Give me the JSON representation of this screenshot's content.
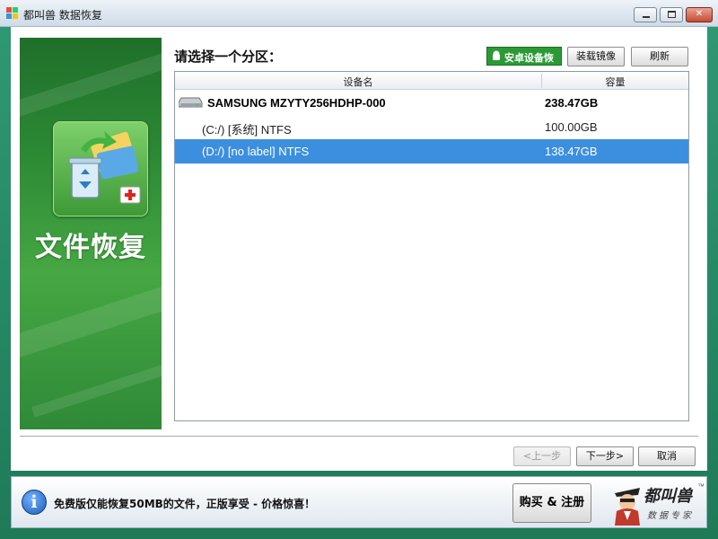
{
  "window": {
    "title": "都叫兽 数据恢复",
    "controls": {
      "minimize": "minimize",
      "maximize": "maximize",
      "close": "✕"
    }
  },
  "banner": {
    "title": "文件恢复"
  },
  "heading": "请选择一个分区：",
  "actions": {
    "android_recovery": "安卓设备恢复",
    "mount_image": "装载镜像",
    "refresh": "刷新"
  },
  "table": {
    "columns": [
      "设备名",
      "容量"
    ],
    "disk": {
      "name": "SAMSUNG MZYTY256HDHP-000",
      "capacity": "238.47GB"
    },
    "partitions": [
      {
        "name": "(C:/) [系统] NTFS",
        "capacity": "100.00GB",
        "selected": false
      },
      {
        "name": "(D:/) [no label] NTFS",
        "capacity": "138.47GB",
        "selected": true
      }
    ]
  },
  "nav": {
    "prev": "<上一步",
    "next": "下一步>",
    "cancel": "取消"
  },
  "footer": {
    "notice": "免费版仅能恢复50MB的文件，正版享受 - 价格惊喜！",
    "buy_register": "购买 & 注册",
    "logo_title": "都叫兽",
    "logo_subtitle": "数据专家",
    "logo_tm": "™"
  },
  "colors": {
    "banner_green": "#2c8a35",
    "android_button": "#2b9a35",
    "selected_row": "#3c8fdf"
  }
}
